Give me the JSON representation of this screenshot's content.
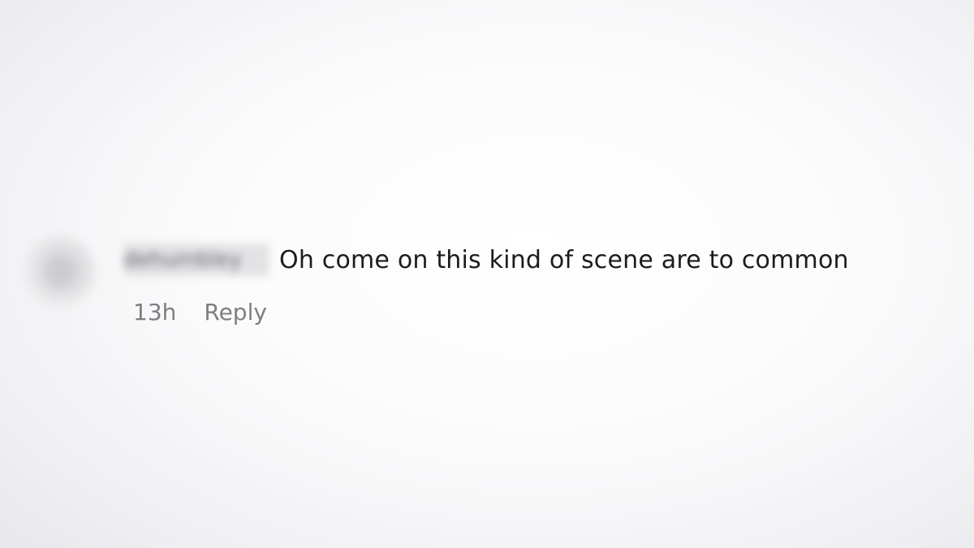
{
  "comment": {
    "username": "dehumbley",
    "text": "Oh come on this kind of scene are to common",
    "timestamp": "13h",
    "reply_label": "Reply"
  }
}
